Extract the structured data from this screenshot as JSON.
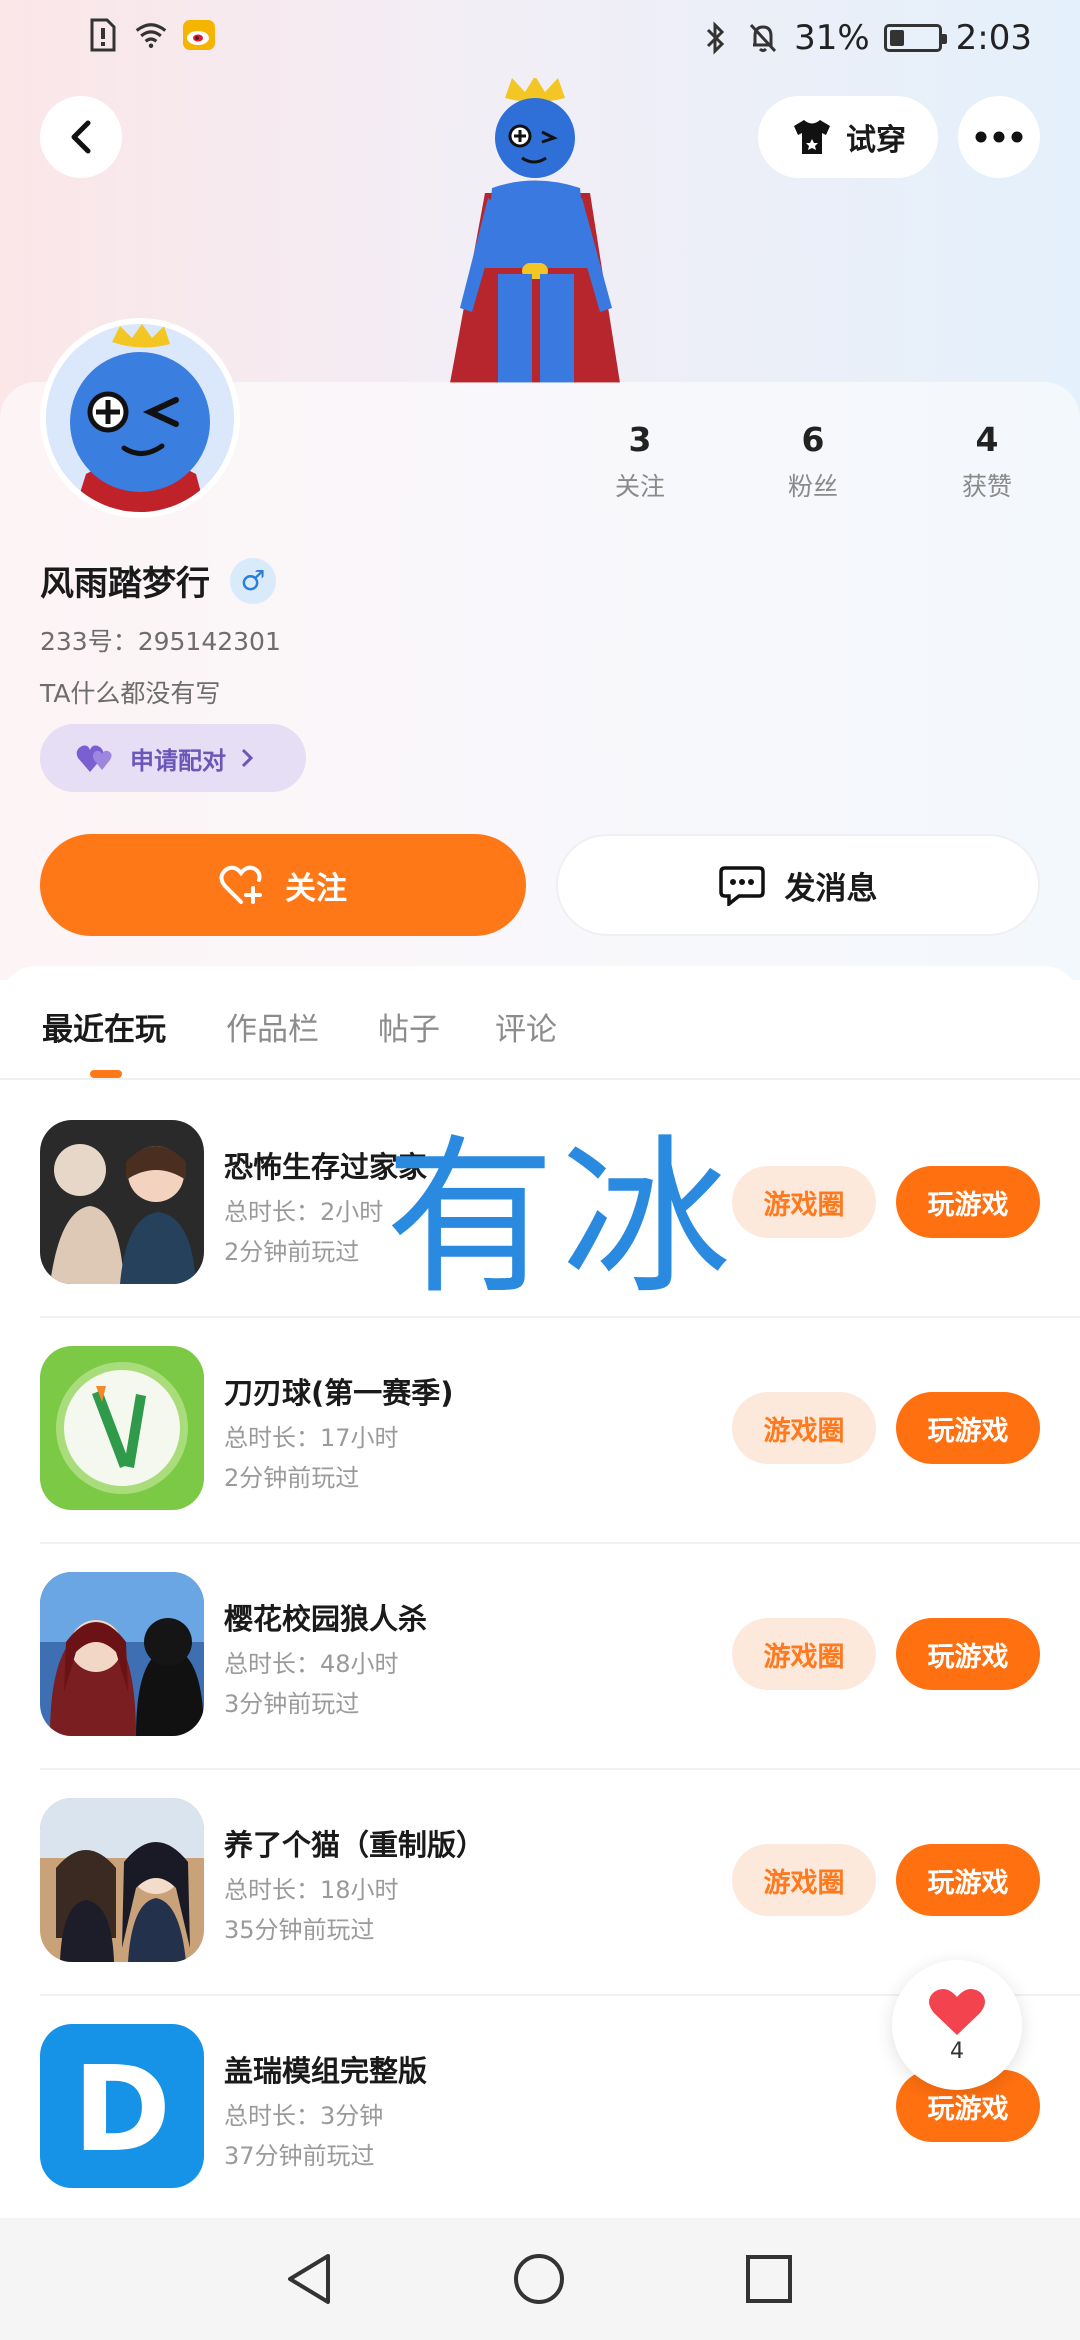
{
  "status_bar": {
    "battery_text": "31%",
    "battery_level": 0.31,
    "time": "2:03"
  },
  "header": {
    "tryon_label": "试穿"
  },
  "profile": {
    "name": "风雨踏梦行",
    "gender_symbol": "♂",
    "uid_text": "233号：295142301",
    "bio": "TA什么都没有写",
    "pair_label": "申请配对",
    "stats": [
      {
        "value": "3",
        "label": "关注"
      },
      {
        "value": "6",
        "label": "粉丝"
      },
      {
        "value": "4",
        "label": "获赞"
      }
    ],
    "follow_label": "关注",
    "message_label": "发消息"
  },
  "tabs": [
    {
      "label": "最近在玩",
      "active": true
    },
    {
      "label": "作品栏",
      "active": false
    },
    {
      "label": "帖子",
      "active": false
    },
    {
      "label": "评论",
      "active": false
    }
  ],
  "games": [
    {
      "title": "恐怖生存过家家",
      "duration": "总时长：2小时",
      "last_played": "2分钟前玩过",
      "circle_label": "游戏圈",
      "play_label": "玩游戏"
    },
    {
      "title": "刀刃球(第一赛季)",
      "duration": "总时长：17小时",
      "last_played": "2分钟前玩过",
      "circle_label": "游戏圈",
      "play_label": "玩游戏"
    },
    {
      "title": "樱花校园狼人杀",
      "duration": "总时长：48小时",
      "last_played": "3分钟前玩过",
      "circle_label": "游戏圈",
      "play_label": "玩游戏"
    },
    {
      "title": "养了个猫（重制版）",
      "duration": "总时长：18小时",
      "last_played": "35分钟前玩过",
      "circle_label": "游戏圈",
      "play_label": "玩游戏"
    },
    {
      "title": "盖瑞模组完整版",
      "duration": "总时长：3分钟",
      "last_played": "37分钟前玩过",
      "circle_label": "",
      "play_label": "玩游戏"
    }
  ],
  "watermark": "有冰",
  "like_float": {
    "count": "4"
  },
  "colors": {
    "accent": "#ff7818",
    "accent_light": "#fde9dc",
    "pair_bg": "#e6def4",
    "pair_text": "#6b57b8"
  }
}
